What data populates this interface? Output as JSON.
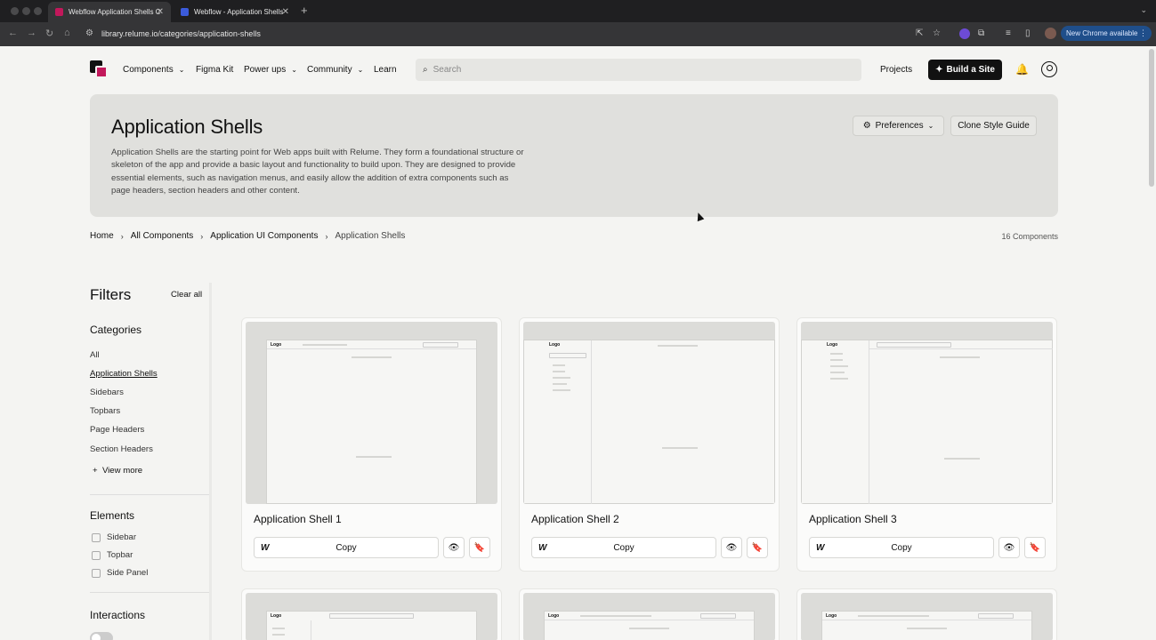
{
  "browser": {
    "tabs": [
      {
        "title": "Webflow Application Shells C",
        "favicon_color": "#c2185b"
      },
      {
        "title": "Webflow - Application Shells",
        "favicon_color": "#3b5bdb"
      }
    ],
    "new_tab_symbol": "+",
    "url": "library.relume.io/categories/application-shells",
    "update_label": "New Chrome available"
  },
  "nav": {
    "items": [
      {
        "label": "Components",
        "has_menu": true
      },
      {
        "label": "Figma Kit",
        "has_menu": false
      },
      {
        "label": "Power ups",
        "has_menu": true
      },
      {
        "label": "Community",
        "has_menu": true
      },
      {
        "label": "Learn",
        "has_menu": false
      }
    ],
    "search_placeholder": "Search",
    "projects_label": "Projects",
    "build_label": "Build a Site"
  },
  "hero": {
    "title": "Application Shells",
    "description": "Application Shells are the starting point for Web apps built with Relume. They form a foundational structure or skeleton of the app and provide a basic layout and functionality to build upon. They are designed to provide essential elements, such as navigation menus, and easily allow the addition of extra components such as page headers, section headers and other content.",
    "preferences_label": "Preferences",
    "clone_label": "Clone Style Guide"
  },
  "breadcrumb": {
    "items": [
      "Home",
      "All Components",
      "Application UI Components",
      "Application Shells"
    ],
    "count": "16 Components"
  },
  "filters": {
    "title": "Filters",
    "clear_label": "Clear all",
    "categories_title": "Categories",
    "categories": [
      "All",
      "Application Shells",
      "Sidebars",
      "Topbars",
      "Page Headers",
      "Section Headers"
    ],
    "selected_category": "Application Shells",
    "view_more_label": "View more",
    "elements_title": "Elements",
    "elements": [
      "Sidebar",
      "Topbar",
      "Side Panel"
    ],
    "interactions_title": "Interactions"
  },
  "cards": [
    {
      "title": "Application Shell 1",
      "copy_label": "Copy",
      "layout": "topbar"
    },
    {
      "title": "Application Shell 2",
      "copy_label": "Copy",
      "layout": "sidebar"
    },
    {
      "title": "Application Shell 3",
      "copy_label": "Copy",
      "layout": "sidebar-topbar"
    }
  ],
  "mock_logo_text": "Logo"
}
